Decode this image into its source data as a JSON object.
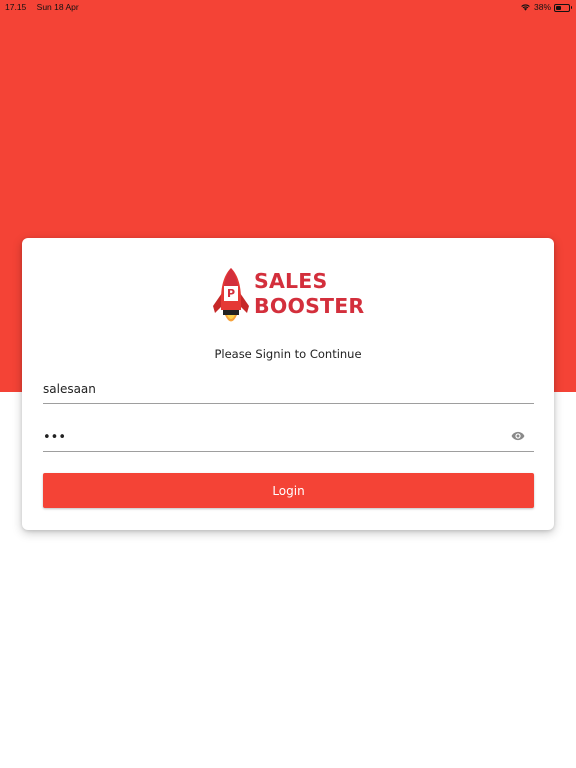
{
  "status_bar": {
    "time": "17.15",
    "date": "Sun 18 Apr",
    "battery_percent": "38%",
    "battery_level": 0.38,
    "icons": [
      "wifi-icon",
      "battery-icon"
    ]
  },
  "brand": {
    "line1": "SALES",
    "line2": "BOOSTER",
    "rocket_badge": "P",
    "color": "#d32f3c"
  },
  "login_form": {
    "subtitle": "Please Signin to Continue",
    "username_value": "salesaan",
    "password_value": "abc",
    "show_password_icon": "eye-icon",
    "login_label": "Login"
  },
  "colors": {
    "primary": "#f44336",
    "background": "#ffffff"
  }
}
